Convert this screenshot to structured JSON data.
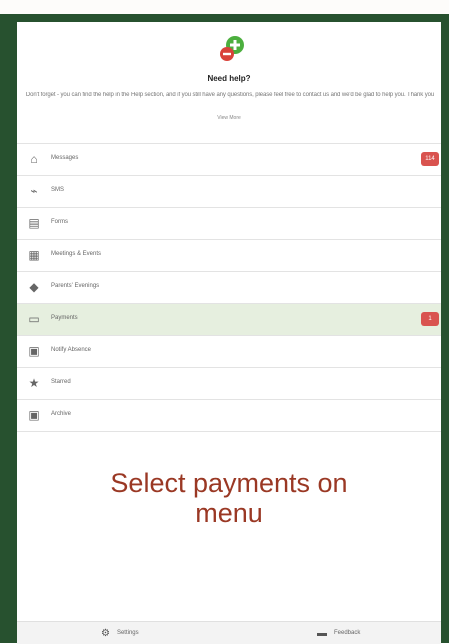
{
  "help": {
    "title": "Need help?",
    "text": "Don't forget - you can find the help in the Help section, and if you still have any questions, please feel free to contact us and we'd be glad to help you. Thank you",
    "view_more": "View More"
  },
  "menu": {
    "items": [
      {
        "name": "messages",
        "label": "Messages",
        "icon": "home-icon",
        "glyph": "⌂",
        "badge": "114",
        "active": false
      },
      {
        "name": "sms",
        "label": "SMS",
        "icon": "signal-icon",
        "glyph": "⌁",
        "badge": "",
        "active": false
      },
      {
        "name": "forms",
        "label": "Forms",
        "icon": "form-icon",
        "glyph": "▤",
        "badge": "",
        "active": false
      },
      {
        "name": "meetings-events",
        "label": "Meetings & Events",
        "icon": "calendar-icon",
        "glyph": "▦",
        "badge": "",
        "active": false
      },
      {
        "name": "parents-evenings",
        "label": "Parents' Evenings",
        "icon": "tag-icon",
        "glyph": "◆",
        "badge": "",
        "active": false
      },
      {
        "name": "payments",
        "label": "Payments",
        "icon": "cart-icon",
        "glyph": "▭",
        "badge": "1",
        "active": true
      },
      {
        "name": "notify-absence",
        "label": "Notify Absence",
        "icon": "id-card-icon",
        "glyph": "▣",
        "badge": "",
        "active": false
      },
      {
        "name": "starred",
        "label": "Starred",
        "icon": "star-icon",
        "glyph": "★",
        "badge": "",
        "active": false
      },
      {
        "name": "archive",
        "label": "Archive",
        "icon": "archive-icon",
        "glyph": "▣",
        "badge": "",
        "active": false
      }
    ]
  },
  "annotation": {
    "line1": "Select payments on",
    "line2": "menu"
  },
  "footer": {
    "settings_label": "Settings",
    "feedback_label": "Feedback"
  },
  "colors": {
    "frame": "#27512f",
    "badge": "#d9534f",
    "active_row": "#e6efdf",
    "annotation": "#9a3824",
    "logo_green": "#4caf3e",
    "logo_red": "#d9423a"
  }
}
